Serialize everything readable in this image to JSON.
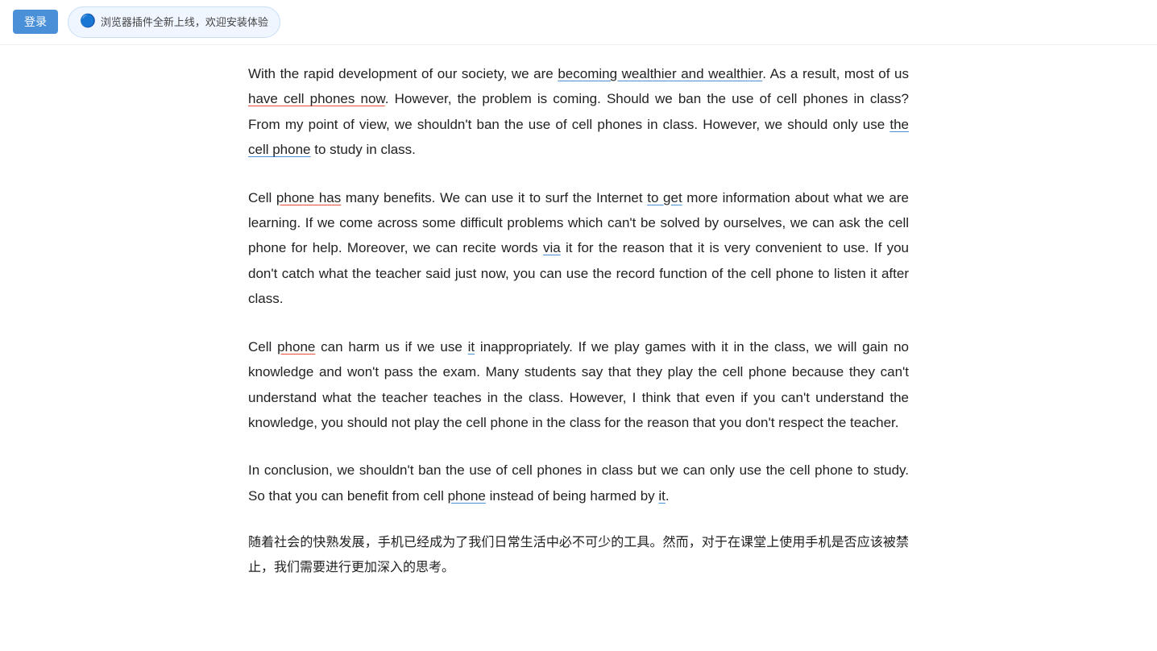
{
  "topbar": {
    "login_label": "登录",
    "plugin_icon": "🔵",
    "plugin_notice": "浏览器插件全新上线，欢迎安装体验"
  },
  "paragraphs": [
    {
      "id": "para1",
      "text_parts": [
        {
          "text": "With the rapid development of our society, we are ",
          "style": "normal"
        },
        {
          "text": "becoming wealthier and wealthier",
          "style": "underline-blue"
        },
        {
          "text": ". As a result, most of us ",
          "style": "normal"
        },
        {
          "text": "have cell phones now",
          "style": "underline-red"
        },
        {
          "text": ". However, the problem is coming. Should we ban the use of cell phones in class? From my point of view, we shouldn’t ban the use of cell phones in class. However, we should only use ",
          "style": "normal"
        },
        {
          "text": "the cell phone",
          "style": "underline-blue"
        },
        {
          "text": " to study in class.",
          "style": "normal"
        }
      ]
    },
    {
      "id": "para2",
      "text_parts": [
        {
          "text": "Cell ",
          "style": "normal"
        },
        {
          "text": "phone has",
          "style": "underline-red"
        },
        {
          "text": " many benefits. We can use it to surf the Internet ",
          "style": "normal"
        },
        {
          "text": "to get",
          "style": "underline-blue"
        },
        {
          "text": " more information about what we are learning. If we come across some difficult problems which can’t be solved by ourselves, we can ask the cell phone for help. Moreover, we can recite words ",
          "style": "normal"
        },
        {
          "text": "via",
          "style": "underline-blue"
        },
        {
          "text": " it for the reason that it is very convenient to use. If you don’t catch what the teacher said just now, you can use the record function of the cell phone to listen it after class.",
          "style": "normal"
        }
      ]
    },
    {
      "id": "para3",
      "text_parts": [
        {
          "text": "Cell ",
          "style": "normal"
        },
        {
          "text": "phone",
          "style": "underline-red"
        },
        {
          "text": " can harm us if we use ",
          "style": "normal"
        },
        {
          "text": "it",
          "style": "underline-blue"
        },
        {
          "text": " inappropriately. If we play games with it in the class, we will gain no knowledge and won’t pass the exam. Many students say that they play the cell phone because they can’t understand what the teacher teaches in the class. However, I think that even if you can’t understand the knowledge, you should not play the cell phone in the class for the reason that you don’t respect the teacher.",
          "style": "normal"
        }
      ]
    },
    {
      "id": "para4",
      "text_parts": [
        {
          "text": "In conclusion, we shouldn’t ban the use of cell phones in class but we can only use the cell phone to study. So that you can benefit from cell ",
          "style": "normal"
        },
        {
          "text": "phone",
          "style": "underline-blue"
        },
        {
          "text": " instead of being harmed by ",
          "style": "normal"
        },
        {
          "text": "it",
          "style": "underline-blue"
        },
        {
          "text": ".",
          "style": "normal"
        }
      ]
    },
    {
      "id": "para5_chinese",
      "text": "随着社会的快熟发展，手机已经成为了我们日常生活中必不可少的工具。然而，对于在课堂上使用手机是否应该被禁止，我们需要进行更加深入的思考。"
    }
  ]
}
